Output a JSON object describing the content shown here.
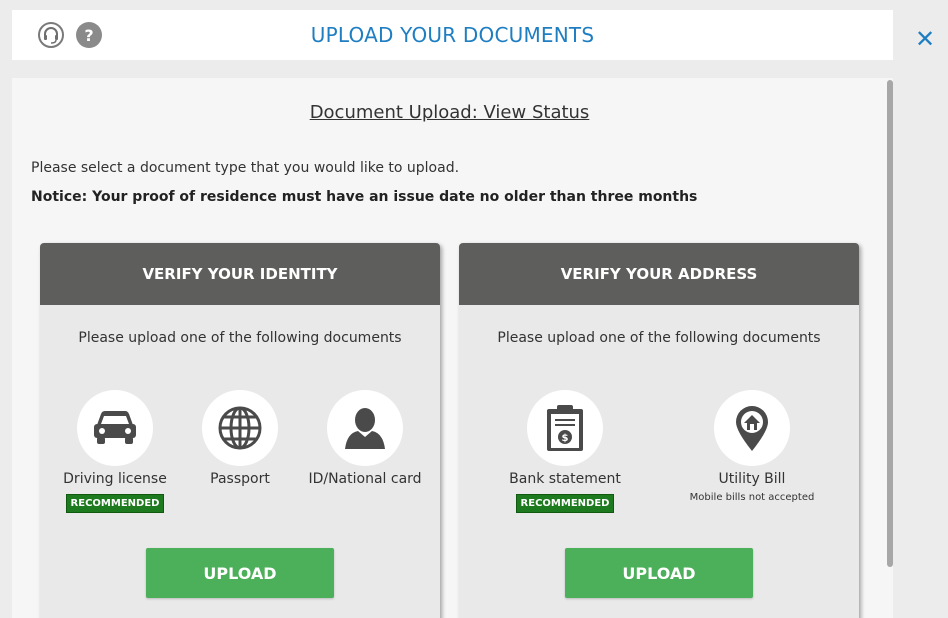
{
  "header": {
    "title": "UPLOAD YOUR DOCUMENTS",
    "support_icon": "headset-support-icon",
    "help_icon": "question-mark-icon",
    "help_symbol": "?",
    "close_icon": "close-icon",
    "close_symbol": "✕"
  },
  "main": {
    "status_link": "Document Upload: View Status",
    "intro": "Please select a document type that you would like to upload.",
    "notice": "Notice: Your proof of residence must have an issue date no older than three months"
  },
  "identity": {
    "title": "VERIFY YOUR IDENTITY",
    "subtitle": "Please upload one of the following documents",
    "docs": [
      {
        "label": "Driving license",
        "icon": "car-icon",
        "badge": "RECOMMENDED"
      },
      {
        "label": "Passport",
        "icon": "globe-icon"
      },
      {
        "label": "ID/National card",
        "icon": "person-icon"
      }
    ],
    "upload_label": "UPLOAD"
  },
  "address": {
    "title": "VERIFY YOUR ADDRESS",
    "subtitle": "Please upload one of the following documents",
    "docs": [
      {
        "label": "Bank statement",
        "icon": "clipboard-dollar-icon",
        "badge": "RECOMMENDED"
      },
      {
        "label": "Utility Bill",
        "icon": "house-location-pin-icon",
        "note": "Mobile bills not accepted"
      }
    ],
    "upload_label": "UPLOAD"
  },
  "colors": {
    "accent_blue": "#1f7ec2",
    "card_header": "#5e5e5c",
    "upload_green": "#4caf5a",
    "badge_green": "#1e7a1e"
  }
}
